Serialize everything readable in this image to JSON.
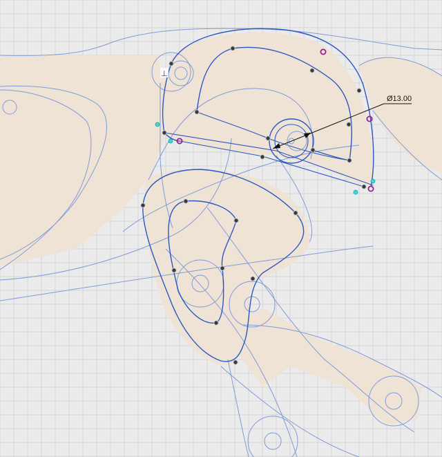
{
  "canvas": {
    "background": "#ebebeb",
    "grid_color": "#d6d6d6",
    "profile_color": "#efe3d6",
    "curve_color": "#2b57c2",
    "construction_color": "#7f9bd8"
  },
  "dimension": {
    "label": "Ø13.00"
  },
  "point_colors": {
    "fixed": "#3a3a3a",
    "midpoint": "#3ed6d6",
    "constraint": "#9a1d8a"
  },
  "glyphs": {
    "coincident_constraint_icon": "⊥"
  }
}
